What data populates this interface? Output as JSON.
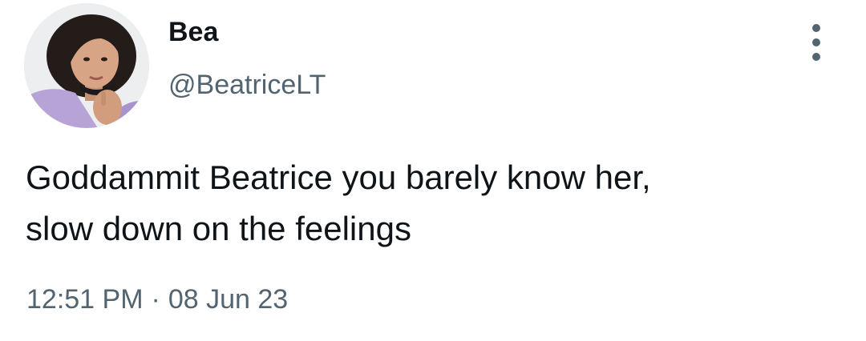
{
  "user": {
    "display_name": "Bea",
    "handle": "@BeatriceLT"
  },
  "tweet": {
    "text_line1": "Goddammit Beatrice you barely know her,",
    "text_line2": "slow down on the feelings",
    "time": "12:51 PM",
    "separator": "·",
    "date": "08 Jun 23"
  },
  "icons": {
    "more": "more-vertical-icon",
    "avatar": "profile-photo"
  },
  "colors": {
    "text": "#0f1419",
    "secondary": "#536471",
    "background": "#ffffff"
  }
}
